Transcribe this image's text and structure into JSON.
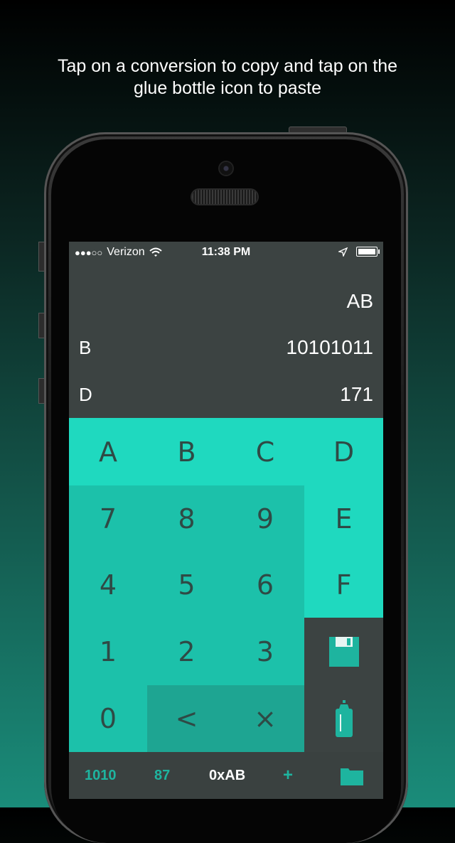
{
  "caption": {
    "line1": "Tap on a conversion to copy and tap on the",
    "line2": "glue bottle icon to paste"
  },
  "status_bar": {
    "signal": "●●●○○",
    "carrier": "Verizon",
    "time": "11:38 PM"
  },
  "display": {
    "input_value": "AB",
    "conversions": [
      {
        "label": "B",
        "value": "10101011"
      },
      {
        "label": "D",
        "value": "171"
      }
    ]
  },
  "keypad": {
    "hex_row": [
      "A",
      "B",
      "C",
      "D"
    ],
    "digits_row1": [
      "7",
      "8",
      "9"
    ],
    "digits_row2": [
      "4",
      "5",
      "6"
    ],
    "digits_row3": [
      "1",
      "2",
      "3"
    ],
    "zero": "0",
    "back": "<",
    "clear": "×",
    "hex_e": "E",
    "hex_f": "F"
  },
  "tabbar": {
    "binary": "1010",
    "octal": "87",
    "hex": "0xAB",
    "add": "+"
  },
  "colors": {
    "key_light": "#1fd9bf",
    "key_mid": "#1cc1aa",
    "key_dark": "#1ea592",
    "display_bg": "#3c4342",
    "tab_accent": "#1eb49f"
  },
  "icons": [
    "wifi-icon",
    "location-arrow-icon",
    "battery-icon",
    "floppy-save-icon",
    "glue-bottle-icon",
    "folder-icon"
  ]
}
